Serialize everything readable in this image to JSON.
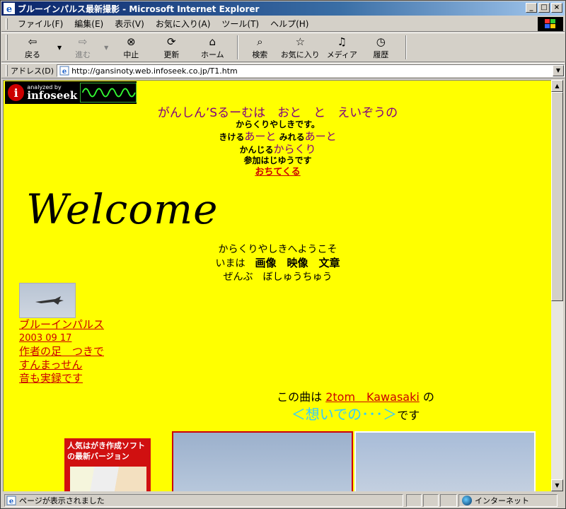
{
  "window": {
    "title": "ブルーインパルス最新撮影 - Microsoft Internet Explorer",
    "buttons": {
      "minimize": "_",
      "maximize": "□",
      "close": "×"
    }
  },
  "menu": [
    "ファイル(F)",
    "編集(E)",
    "表示(V)",
    "お気に入り(A)",
    "ツール(T)",
    "ヘルプ(H)"
  ],
  "toolbar": {
    "back": "戻る",
    "forward": "進む",
    "stop": "中止",
    "refresh": "更新",
    "home": "ホーム",
    "search": "検索",
    "favorites": "お気に入り",
    "media": "メディア",
    "history": "履歴"
  },
  "address": {
    "label": "アドレス(D)",
    "url": "http://gansinoty.web.infoseek.co.jp/T1.htm"
  },
  "page": {
    "infoseek": {
      "small": "analyzed by",
      "brand": "infoseek"
    },
    "heading": "がんしん’Sるーむは　おと　と　えいぞうの",
    "line1": "からくりやしきです。",
    "line2_a": "きける",
    "line2_b": "あーと",
    "line2_c": "みれる",
    "line2_d": "あーと",
    "line3_a": "かんじる",
    "line3_b": "からくり",
    "line4": "参加はじゆうです",
    "mail_link": "おちてくる",
    "welcome": "Welcome",
    "intro1": "からくりやしきへようこそ",
    "intro2_a": "いまは",
    "intro2_b": "画像　映像　文章",
    "intro3": "ぜんぶ　ぼしゅうちゅう",
    "jet_links": {
      "title": "ブルーインパルス",
      "date": "2003 09 17",
      "note1": "作者の足　つきで",
      "note2": "すんまっせん",
      "note3": "音も実録です"
    },
    "song": {
      "prefix": "この曲は",
      "artist": "2tom　Kawasaki",
      "particle": "の",
      "title": "＜想いでの･･･＞",
      "suffix": "です"
    },
    "ad": {
      "line1": "人気はがき作成ソフト",
      "line2": "の最新バージョン"
    }
  },
  "status": {
    "text": "ページが表示されました",
    "zone": "インターネット"
  }
}
